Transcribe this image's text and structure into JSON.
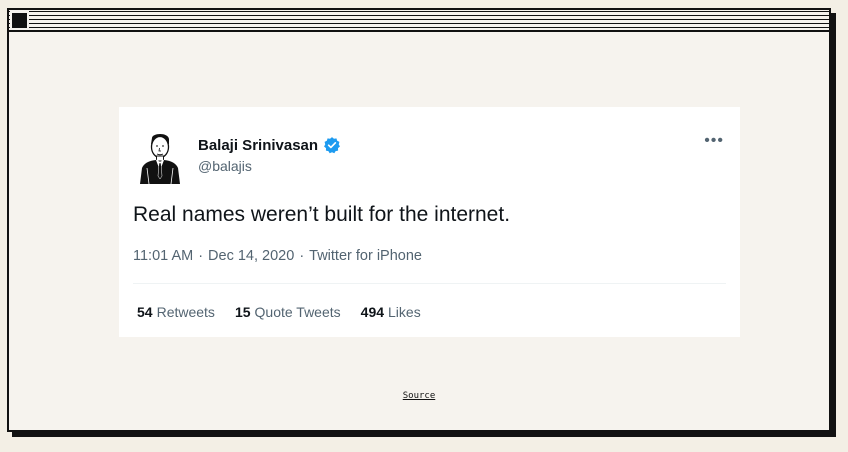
{
  "tweet": {
    "author_name": "Balaji Srinivasan",
    "handle": "@balajis",
    "verified": true,
    "text": "Real names weren’t built for the internet.",
    "time": "11:01 AM",
    "separator": "·",
    "date": "Dec 14, 2020",
    "client": "Twitter for iPhone",
    "more_label": "•••",
    "stats": {
      "retweets_count": "54",
      "retweets_label": "Retweets",
      "quotes_count": "15",
      "quotes_label": "Quote Tweets",
      "likes_count": "494",
      "likes_label": "Likes"
    }
  },
  "footer": {
    "source_label": "Source"
  },
  "colors": {
    "background": "#f3efe5",
    "window_border": "#111111",
    "verified_blue": "#1d9bf0",
    "text_primary": "#0f1419",
    "text_secondary": "#536471"
  },
  "icons": {
    "verified": "verified-badge-icon",
    "more": "more-icon",
    "close": "close-box-icon"
  }
}
